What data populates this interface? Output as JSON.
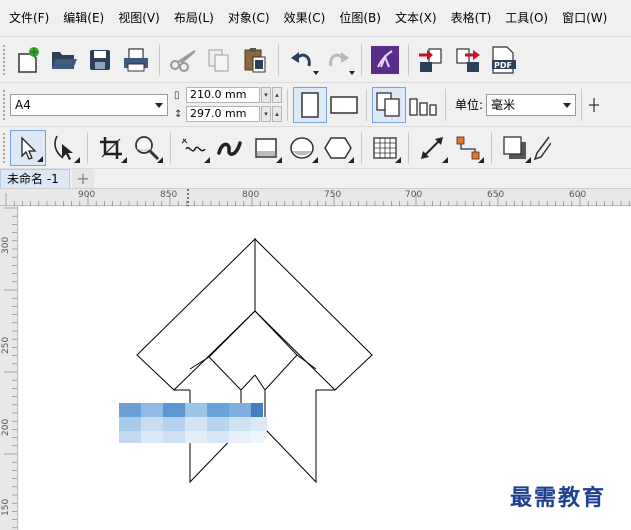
{
  "menu": [
    "文件(F)",
    "编辑(E)",
    "视图(V)",
    "布局(L)",
    "对象(C)",
    "效果(C)",
    "位图(B)",
    "文本(X)",
    "表格(T)",
    "工具(O)",
    "窗口(W)"
  ],
  "property_bar": {
    "page_size": "A4",
    "width": "210.0 mm",
    "height": "297.0 mm",
    "unit_label": "单位:",
    "unit_value": "毫米"
  },
  "document": {
    "tab_title": "未命名 -1",
    "add_tab": "+"
  },
  "rulers": {
    "horizontal_labels": [
      "900",
      "850",
      "800",
      "750",
      "700",
      "650",
      "600"
    ],
    "vertical_labels": [
      "300",
      "250",
      "200",
      "150"
    ]
  },
  "watermark": "最需教育",
  "colors": {
    "accent_purple": "#5b2d8a",
    "watermark_blue": "#1f3f8f",
    "tab_blue": "#dce8f6"
  }
}
